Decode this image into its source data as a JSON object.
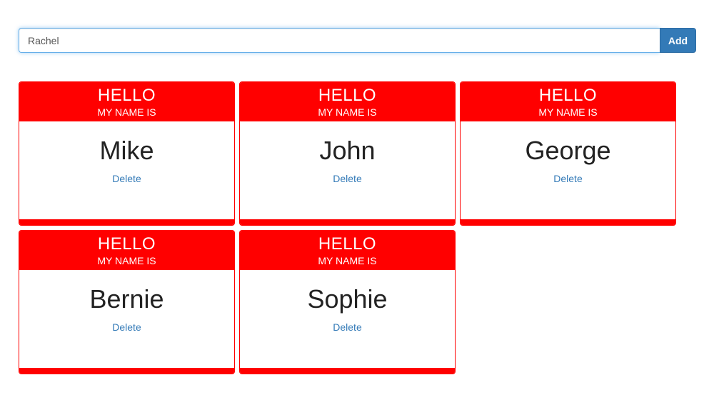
{
  "form": {
    "input_value": "Rachel",
    "add_label": "Add"
  },
  "card_template": {
    "hello": "HELLO",
    "subtitle": "MY NAME IS",
    "delete_label": "Delete"
  },
  "cards": [
    {
      "name": "Mike"
    },
    {
      "name": "John"
    },
    {
      "name": "George"
    },
    {
      "name": "Bernie"
    },
    {
      "name": "Sophie"
    }
  ],
  "colors": {
    "accent_red": "#ff0000",
    "button_blue": "#337ab7",
    "link_blue": "#337ab7"
  }
}
